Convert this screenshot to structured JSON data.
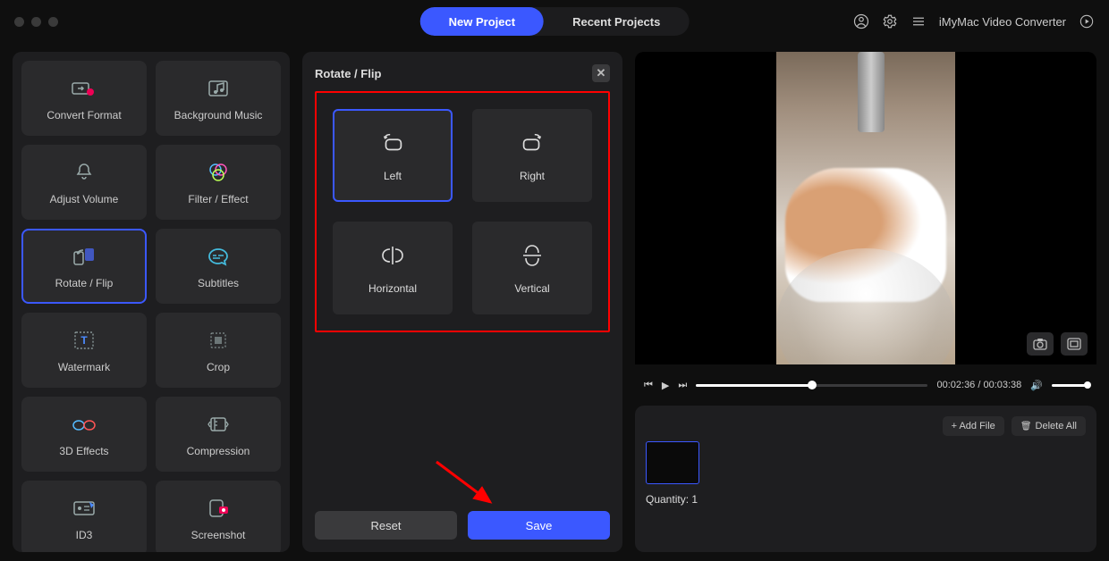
{
  "header": {
    "tabs": {
      "new": "New Project",
      "recent": "Recent Projects"
    },
    "appname": "iMyMac Video Converter"
  },
  "tools": [
    "Convert Format",
    "Background Music",
    "Adjust Volume",
    "Filter / Effect",
    "Rotate / Flip",
    "Subtitles",
    "Watermark",
    "Crop",
    "3D Effects",
    "Compression",
    "ID3",
    "Screenshot"
  ],
  "editor": {
    "title": "Rotate / Flip",
    "opts": [
      "Left",
      "Right",
      "Horizontal",
      "Vertical"
    ],
    "reset": "Reset",
    "save": "Save"
  },
  "playback": {
    "time": "00:02:36 / 00:03:38"
  },
  "files": {
    "add": "+ Add File",
    "delete": "Delete All",
    "quantity_label": "Quantity:",
    "quantity": "1"
  }
}
